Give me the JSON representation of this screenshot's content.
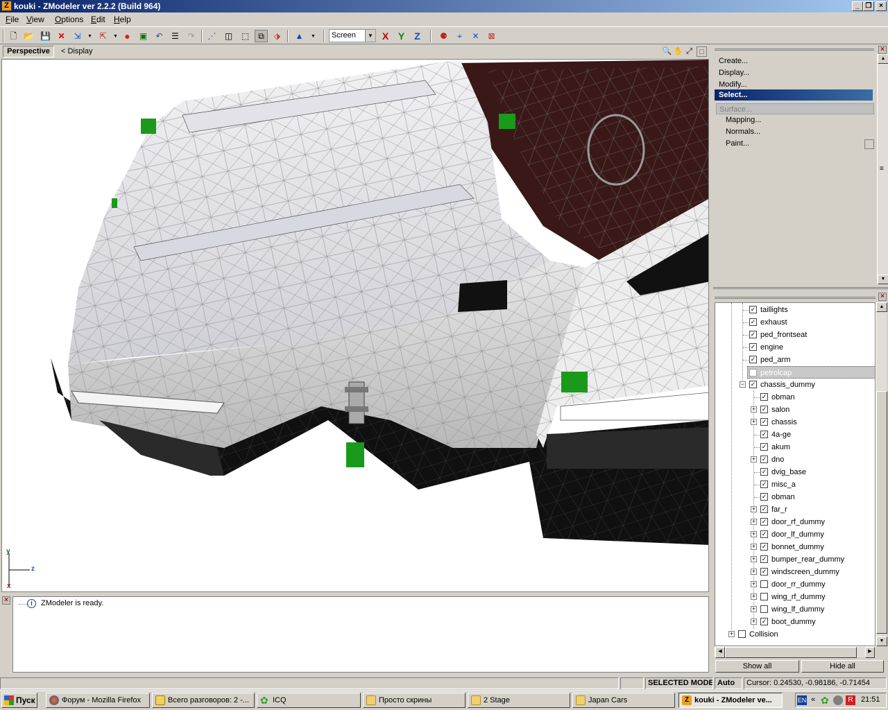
{
  "window": {
    "title": "kouki - ZModeler ver 2.2.2 (Build 964)",
    "logo": "Z"
  },
  "menu": [
    "File",
    "View",
    "Options",
    "Edit",
    "Help"
  ],
  "toolbar": {
    "coord_mode": "Screen",
    "axis_x": "X",
    "axis_y": "Y",
    "axis_z": "Z"
  },
  "viewport": {
    "label": "Perspective",
    "display": "<  Display",
    "axis_y": "y",
    "axis_z": "z",
    "axis_x": "x"
  },
  "commands": {
    "create": "Create...",
    "display": "Display...",
    "modify": "Modify...",
    "select": "Select...",
    "surface": "Surface...",
    "mapping": "Mapping...",
    "normals": "Normals...",
    "paint": "Paint..."
  },
  "tree": [
    {
      "label": "taillights",
      "checked": true
    },
    {
      "label": "exhaust",
      "checked": true
    },
    {
      "label": "ped_frontseat",
      "checked": true
    },
    {
      "label": "engine",
      "checked": true
    },
    {
      "label": "ped_arm",
      "checked": true
    },
    {
      "label": "petrolcap",
      "checked": false
    },
    {
      "label": "chassis_dummy",
      "checked": true
    },
    {
      "label": "obman",
      "checked": true
    },
    {
      "label": "salon",
      "checked": true
    },
    {
      "label": "chassis",
      "checked": true
    },
    {
      "label": "4a-ge",
      "checked": true
    },
    {
      "label": "akum",
      "checked": true
    },
    {
      "label": "dno",
      "checked": true
    },
    {
      "label": "dvig_base",
      "checked": true
    },
    {
      "label": "misc_a",
      "checked": true
    },
    {
      "label": "obman",
      "checked": true
    },
    {
      "label": "far_r",
      "checked": true
    },
    {
      "label": "door_rf_dummy",
      "checked": true
    },
    {
      "label": "door_lf_dummy",
      "checked": true
    },
    {
      "label": "bonnet_dummy",
      "checked": true
    },
    {
      "label": "bumper_rear_dummy",
      "checked": true
    },
    {
      "label": "windscreen_dummy",
      "checked": true
    },
    {
      "label": "door_rr_dummy",
      "checked": false
    },
    {
      "label": "wing_rf_dummy",
      "checked": false
    },
    {
      "label": "wing_lf_dummy",
      "checked": false
    },
    {
      "label": "boot_dummy",
      "checked": true
    },
    {
      "label": "Collision",
      "checked": false
    }
  ],
  "buttons": {
    "show_all": "Show all",
    "hide_all": "Hide all"
  },
  "log": {
    "message": "ZModeler is ready."
  },
  "status": {
    "mode": "SELECTED MODE",
    "auto": "Auto",
    "cursor": "Cursor: 0.24530, -0.98186, -0.71454"
  },
  "taskbar": {
    "start": "Пуск",
    "tasks": [
      "Форум - Mozilla Firefox",
      "Всего разговоров: 2 -...",
      "ICQ",
      "Просто скрины",
      "2 Stage",
      "Japan Cars",
      "kouki - ZModeler ve..."
    ],
    "lang": "EN",
    "clock": "21:51"
  },
  "colors": {
    "dummy_green": "#1a9a1a",
    "selection": "#0a246a",
    "interior": "#5a1f1f"
  }
}
